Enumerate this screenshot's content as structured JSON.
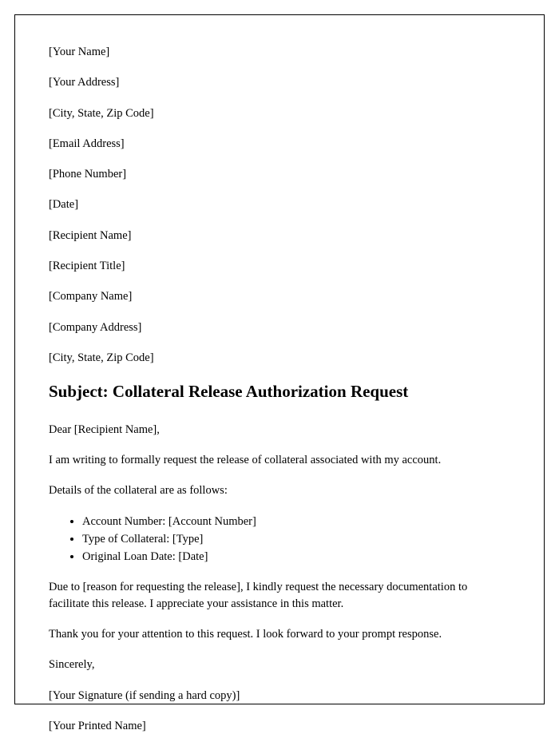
{
  "header": {
    "your_name": "[Your Name]",
    "your_address": "[Your Address]",
    "your_city_state_zip": "[City, State, Zip Code]",
    "email": "[Email Address]",
    "phone": "[Phone Number]",
    "date": "[Date]",
    "recipient_name": "[Recipient Name]",
    "recipient_title": "[Recipient Title]",
    "company_name": "[Company Name]",
    "company_address": "[Company Address]",
    "company_city_state_zip": "[City, State, Zip Code]"
  },
  "subject": "Subject: Collateral Release Authorization Request",
  "salutation": "Dear [Recipient Name],",
  "body": {
    "intro": "I am writing to formally request the release of collateral associated with my account.",
    "details_intro": "Details of the collateral are as follows:",
    "details": {
      "account_number": "Account Number: [Account Number]",
      "type_of_collateral": "Type of Collateral: [Type]",
      "original_loan_date": "Original Loan Date: [Date]"
    },
    "reason": "Due to [reason for requesting the release], I kindly request the necessary documentation to facilitate this release. I appreciate your assistance in this matter.",
    "thanks": "Thank you for your attention to this request. I look forward to your prompt response."
  },
  "closing": {
    "sincerely": "Sincerely,",
    "signature": "[Your Signature (if sending a hard copy)]",
    "printed_name": "[Your Printed Name]"
  }
}
